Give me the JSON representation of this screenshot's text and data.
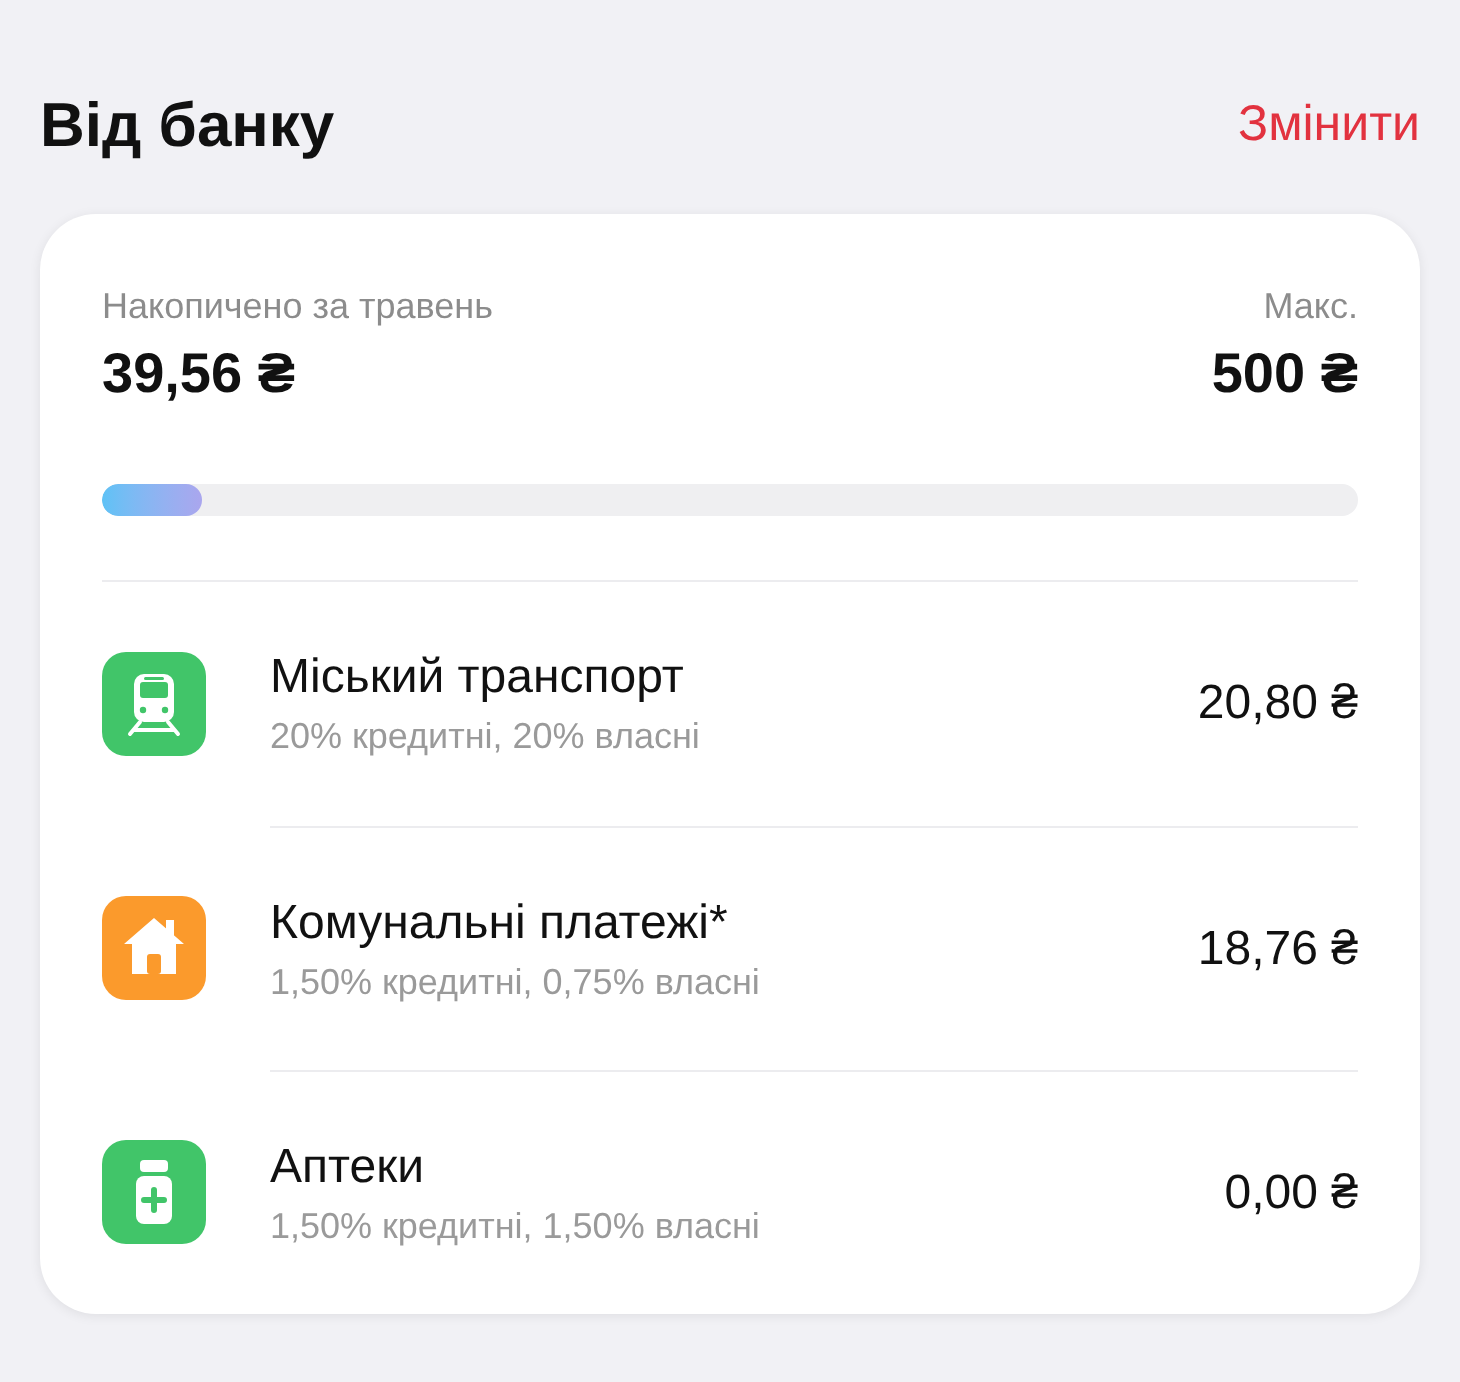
{
  "header": {
    "title": "Від банку",
    "action": "Змінити"
  },
  "summary": {
    "label": "Накопичено за травень",
    "amount": "39,56 ₴",
    "max_label": "Макс.",
    "max_amount": "500 ₴",
    "level": 0.079
  },
  "categories": [
    {
      "name": "Міський транспорт",
      "rates": "20% кредитні, 20% власні",
      "amount": "20,80 ₴",
      "color": "#41c569"
    },
    {
      "name": "Комунальні платежі*",
      "rates": "1,50% кредитні, 0,75% власні",
      "amount": "18,76 ₴",
      "color": "#fb9a2c"
    },
    {
      "name": "Аптеки",
      "rates": "1,50% кредитні, 1,50% власні",
      "amount": "0,00 ₴",
      "color": "#41c569"
    }
  ]
}
